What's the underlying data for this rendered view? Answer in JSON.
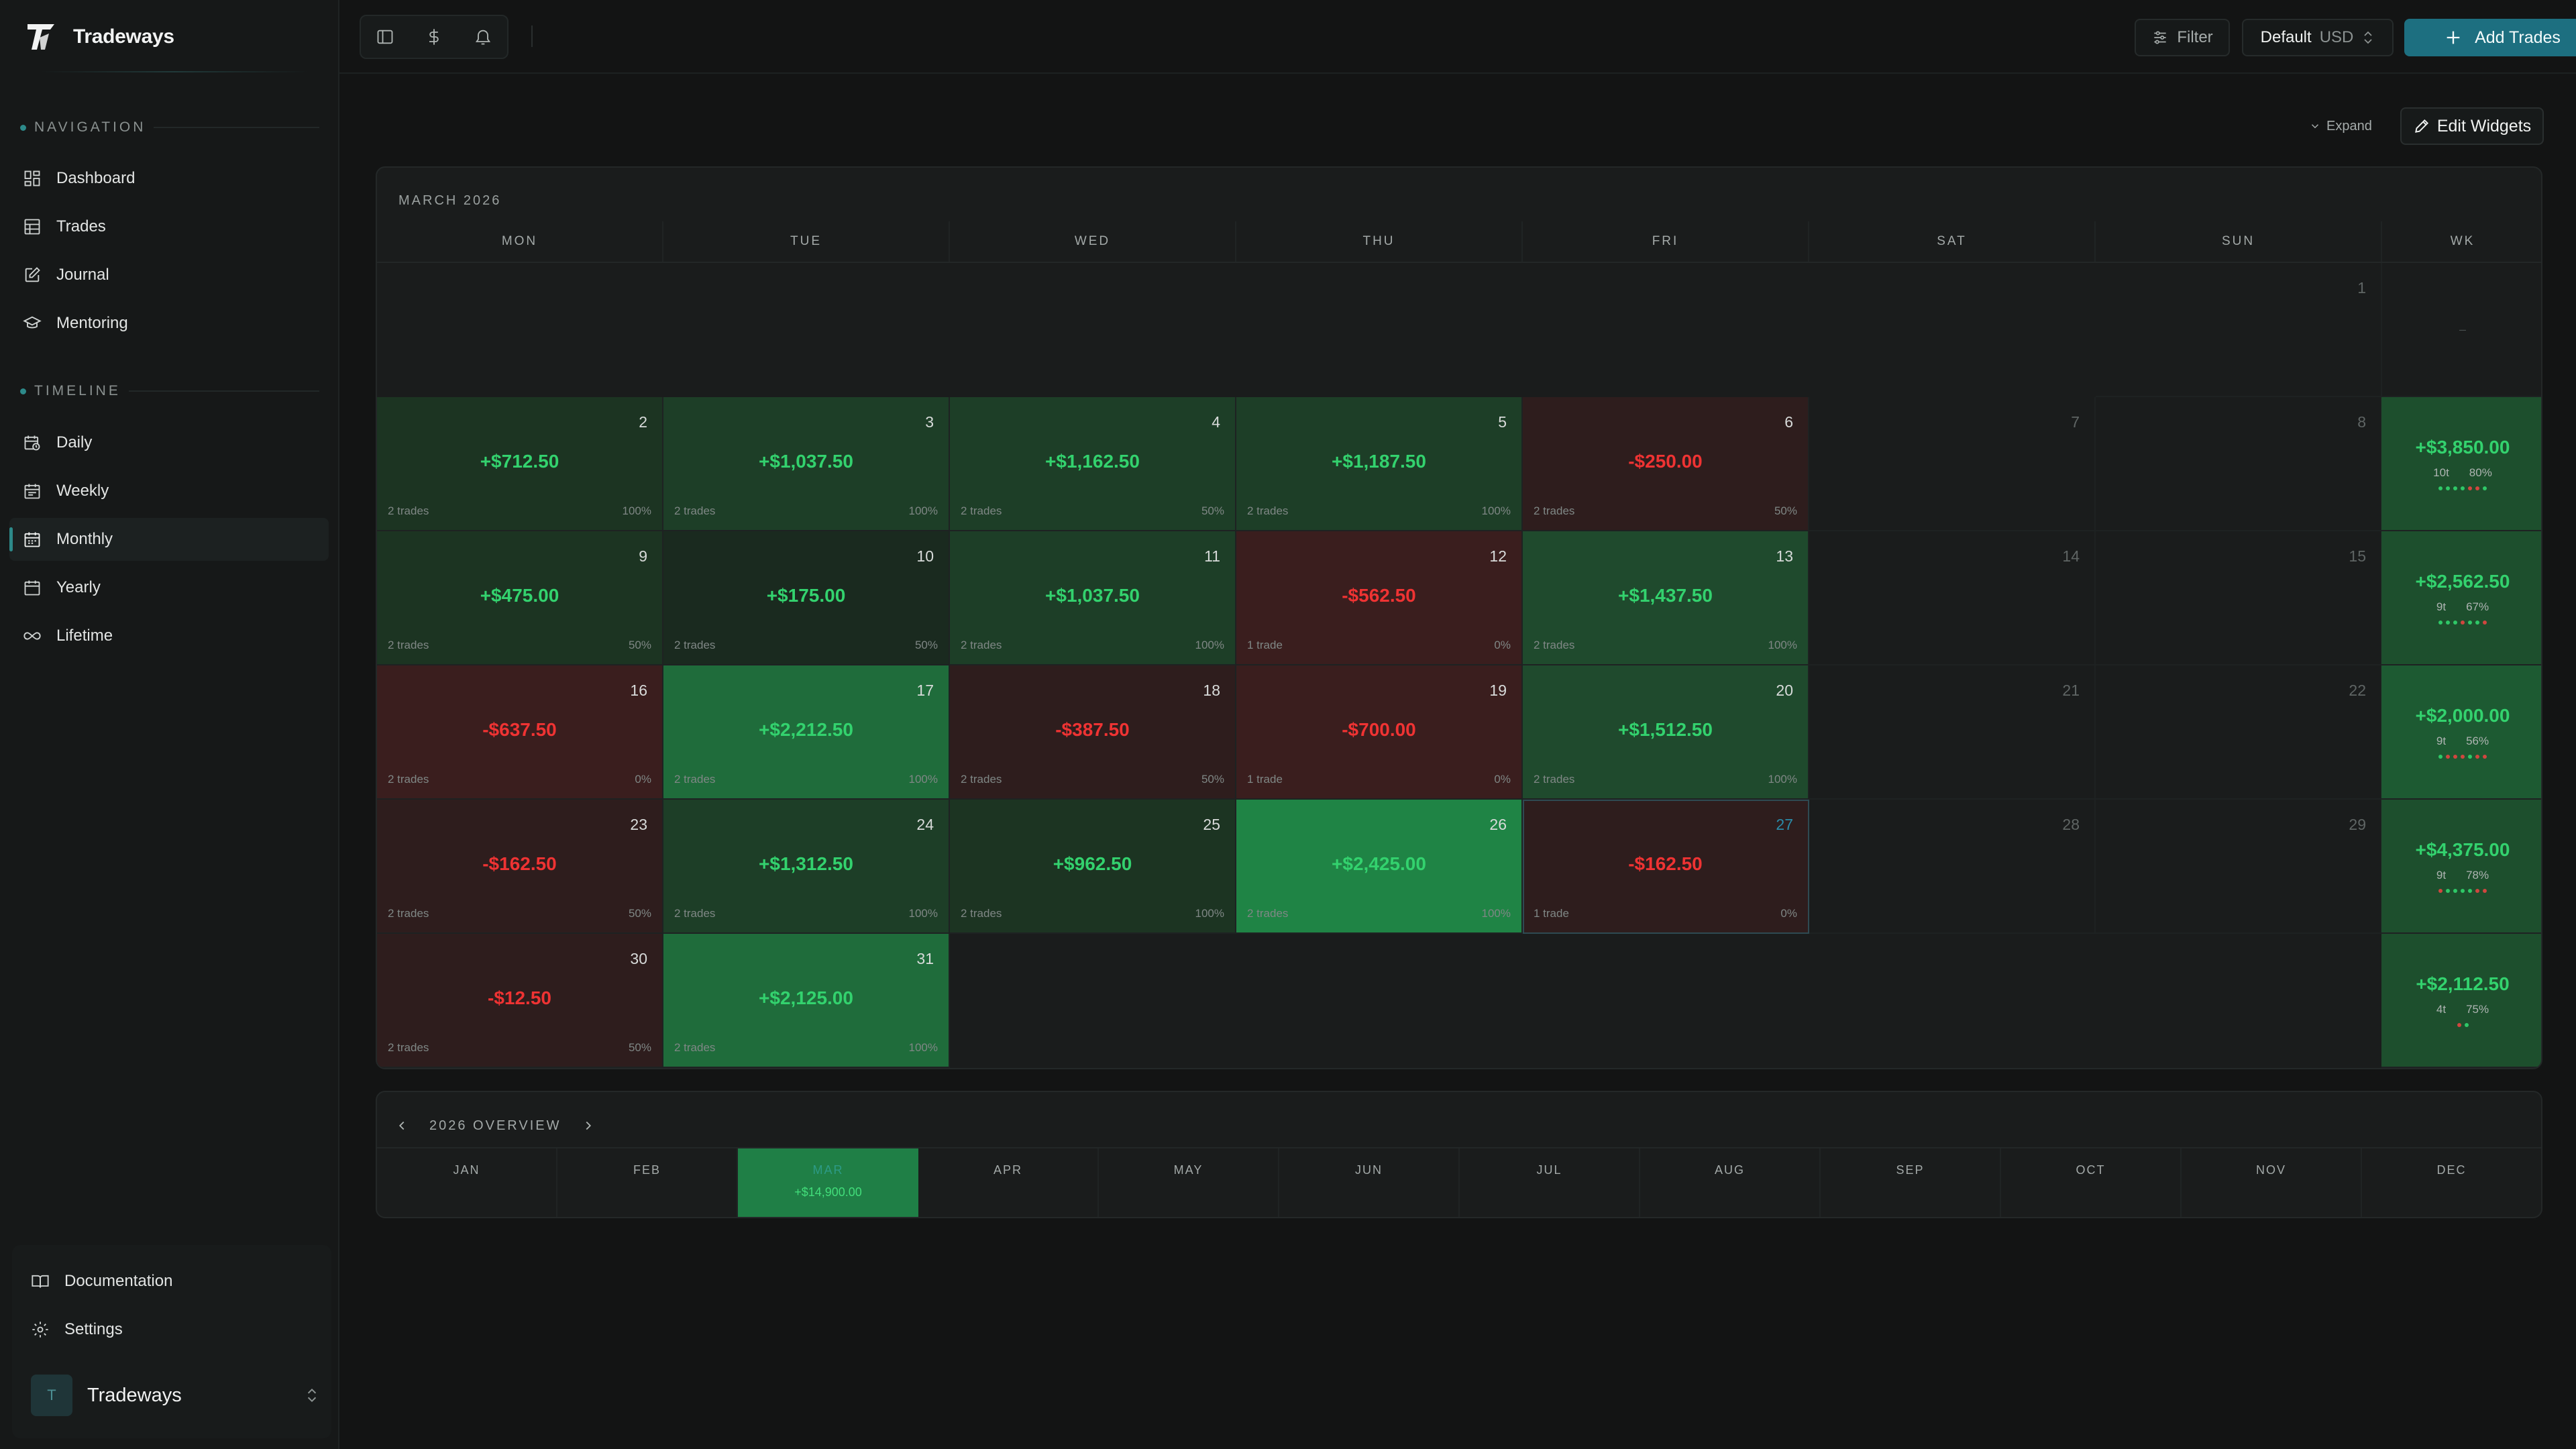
{
  "brand": {
    "name": "Tradeways"
  },
  "sidebar": {
    "nav_section": "NAVIGATION",
    "nav": [
      {
        "label": "Dashboard",
        "icon": "dashboard-icon"
      },
      {
        "label": "Trades",
        "icon": "table-icon"
      },
      {
        "label": "Journal",
        "icon": "journal-icon"
      },
      {
        "label": "Mentoring",
        "icon": "mortarboard-icon"
      }
    ],
    "timeline_section": "TIMELINE",
    "timeline": [
      {
        "label": "Daily",
        "icon": "calendar-clock-icon"
      },
      {
        "label": "Weekly",
        "icon": "calendar-week-icon"
      },
      {
        "label": "Monthly",
        "icon": "calendar-icon",
        "active": true
      },
      {
        "label": "Yearly",
        "icon": "calendar-year-icon"
      },
      {
        "label": "Lifetime",
        "icon": "infinity-icon"
      }
    ],
    "bottom": [
      {
        "label": "Documentation",
        "icon": "book-icon"
      },
      {
        "label": "Settings",
        "icon": "gear-icon"
      }
    ],
    "account": {
      "initial": "T",
      "name": "Tradeways"
    }
  },
  "topbar": {
    "filter_label": "Filter",
    "account_name": "Default",
    "currency": "USD",
    "add_label": "Add Trades"
  },
  "toolbar": {
    "expand_label": "Expand",
    "edit_label": "Edit Widgets"
  },
  "calendar": {
    "month_title": "MARCH 2026",
    "weekdays": [
      "MON",
      "TUE",
      "WED",
      "THU",
      "FRI",
      "SAT",
      "SUN"
    ],
    "week_header": "WK",
    "colors": {
      "positive": "#33d26e",
      "negative": "#ef3333"
    },
    "weeks": [
      {
        "days": [
          null,
          null,
          null,
          null,
          null,
          null,
          {
            "day": "1",
            "empty": true
          }
        ],
        "summary": {
          "placeholder": "–"
        }
      },
      {
        "days": [
          {
            "day": "2",
            "pnl": "+$712.50",
            "trades": "2 trades",
            "rate": "100%",
            "sign": "pos",
            "shade": 1
          },
          {
            "day": "3",
            "pnl": "+$1,037.50",
            "trades": "2 trades",
            "rate": "100%",
            "sign": "pos",
            "shade": 2
          },
          {
            "day": "4",
            "pnl": "+$1,162.50",
            "trades": "2 trades",
            "rate": "50%",
            "sign": "pos",
            "shade": 2
          },
          {
            "day": "5",
            "pnl": "+$1,187.50",
            "trades": "2 trades",
            "rate": "100%",
            "sign": "pos",
            "shade": 2
          },
          {
            "day": "6",
            "pnl": "-$250.00",
            "trades": "2 trades",
            "rate": "50%",
            "sign": "neg",
            "shade": 1
          },
          {
            "day": "7",
            "empty": true
          },
          {
            "day": "8",
            "empty": true
          }
        ],
        "summary": {
          "pnl": "+$3,850.00",
          "trades": "10t",
          "rate": "80%",
          "dots": [
            "g",
            "g",
            "g",
            "g",
            "r",
            "r",
            "g"
          ]
        }
      },
      {
        "days": [
          {
            "day": "9",
            "pnl": "+$475.00",
            "trades": "2 trades",
            "rate": "50%",
            "sign": "pos",
            "shade": 1
          },
          {
            "day": "10",
            "pnl": "+$175.00",
            "trades": "2 trades",
            "rate": "50%",
            "sign": "pos",
            "shade": 0
          },
          {
            "day": "11",
            "pnl": "+$1,037.50",
            "trades": "2 trades",
            "rate": "100%",
            "sign": "pos",
            "shade": 2
          },
          {
            "day": "12",
            "pnl": "-$562.50",
            "trades": "1 trade",
            "rate": "0%",
            "sign": "neg",
            "shade": 2
          },
          {
            "day": "13",
            "pnl": "+$1,437.50",
            "trades": "2 trades",
            "rate": "100%",
            "sign": "pos",
            "shade": 3
          },
          {
            "day": "14",
            "empty": true
          },
          {
            "day": "15",
            "empty": true
          }
        ],
        "summary": {
          "pnl": "+$2,562.50",
          "trades": "9t",
          "rate": "67%",
          "dots": [
            "g",
            "g",
            "g",
            "r",
            "g",
            "g",
            "r"
          ]
        }
      },
      {
        "days": [
          {
            "day": "16",
            "pnl": "-$637.50",
            "trades": "2 trades",
            "rate": "0%",
            "sign": "neg",
            "shade": 2
          },
          {
            "day": "17",
            "pnl": "+$2,212.50",
            "trades": "2 trades",
            "rate": "100%",
            "sign": "pos",
            "shade": 4
          },
          {
            "day": "18",
            "pnl": "-$387.50",
            "trades": "2 trades",
            "rate": "50%",
            "sign": "neg",
            "shade": 1
          },
          {
            "day": "19",
            "pnl": "-$700.00",
            "trades": "1 trade",
            "rate": "0%",
            "sign": "neg",
            "shade": 2
          },
          {
            "day": "20",
            "pnl": "+$1,512.50",
            "trades": "2 trades",
            "rate": "100%",
            "sign": "pos",
            "shade": 3
          },
          {
            "day": "21",
            "empty": true
          },
          {
            "day": "22",
            "empty": true
          }
        ],
        "summary": {
          "pnl": "+$2,000.00",
          "trades": "9t",
          "rate": "56%",
          "dots": [
            "g",
            "r",
            "r",
            "r",
            "g",
            "r",
            "r"
          ]
        }
      },
      {
        "days": [
          {
            "day": "23",
            "pnl": "-$162.50",
            "trades": "2 trades",
            "rate": "50%",
            "sign": "neg",
            "shade": 1
          },
          {
            "day": "24",
            "pnl": "+$1,312.50",
            "trades": "2 trades",
            "rate": "100%",
            "sign": "pos",
            "shade": 2
          },
          {
            "day": "25",
            "pnl": "+$962.50",
            "trades": "2 trades",
            "rate": "100%",
            "sign": "pos",
            "shade": 1
          },
          {
            "day": "26",
            "pnl": "+$2,425.00",
            "trades": "2 trades",
            "rate": "100%",
            "sign": "pos",
            "shade": 5
          },
          {
            "day": "27",
            "pnl": "-$162.50",
            "trades": "1 trade",
            "rate": "0%",
            "sign": "neg",
            "shade": 1,
            "today": true
          },
          {
            "day": "28",
            "empty": true
          },
          {
            "day": "29",
            "empty": true
          }
        ],
        "summary": {
          "pnl": "+$4,375.00",
          "trades": "9t",
          "rate": "78%",
          "dots": [
            "r",
            "g",
            "g",
            "g",
            "g",
            "r",
            "r"
          ]
        }
      },
      {
        "days": [
          {
            "day": "30",
            "pnl": "-$12.50",
            "trades": "2 trades",
            "rate": "50%",
            "sign": "neg",
            "shade": 1
          },
          {
            "day": "31",
            "pnl": "+$2,125.00",
            "trades": "2 trades",
            "rate": "100%",
            "sign": "pos",
            "shade": 4
          },
          null,
          null,
          null,
          null,
          null
        ],
        "summary": {
          "pnl": "+$2,112.50",
          "trades": "4t",
          "rate": "75%",
          "dots": [
            "r",
            "g"
          ]
        }
      }
    ]
  },
  "overview": {
    "title": "2026 OVERVIEW",
    "months": [
      {
        "name": "JAN"
      },
      {
        "name": "FEB"
      },
      {
        "name": "MAR",
        "value": "+$14,900.00",
        "current": true
      },
      {
        "name": "APR"
      },
      {
        "name": "MAY"
      },
      {
        "name": "JUN"
      },
      {
        "name": "JUL"
      },
      {
        "name": "AUG"
      },
      {
        "name": "SEP"
      },
      {
        "name": "OCT"
      },
      {
        "name": "NOV"
      },
      {
        "name": "DEC"
      }
    ]
  }
}
